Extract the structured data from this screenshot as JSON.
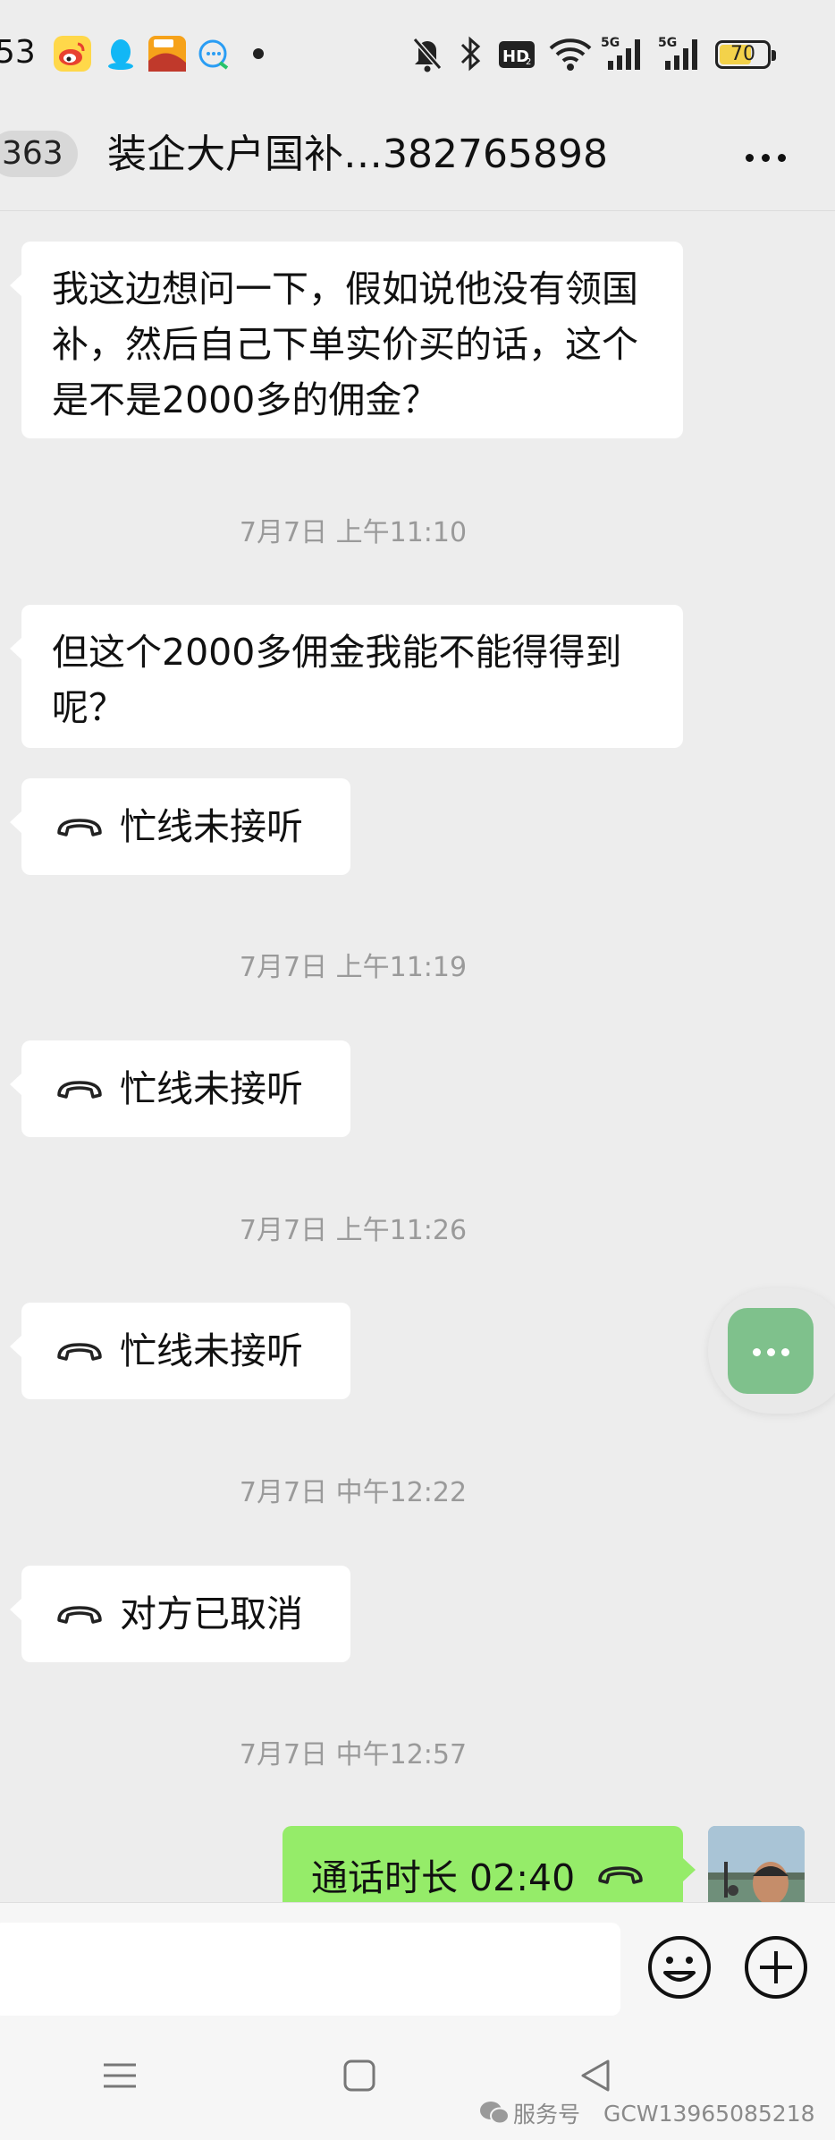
{
  "status_bar": {
    "time": "53",
    "battery": "70",
    "battery_level": 0.7,
    "signal_1": "5G",
    "signal_2": "5G",
    "hd_badge": "HD2"
  },
  "header": {
    "unread_count": "363",
    "title": "装企大户国补…382765898"
  },
  "messages": [
    {
      "type": "text",
      "text": "我这边想问一下，假如说他没有领国补，然后自己下单实价买的话，这个是不是2000多的佣金？"
    },
    {
      "type": "time",
      "text": "7月7日 上午11:10"
    },
    {
      "type": "text",
      "text": "但这个2000多佣金我能不能得得到呢？"
    },
    {
      "type": "call",
      "text": "忙线未接听"
    },
    {
      "type": "time",
      "text": "7月7日 上午11:19"
    },
    {
      "type": "call",
      "text": "忙线未接听"
    },
    {
      "type": "time",
      "text": "7月7日 上午11:26"
    },
    {
      "type": "call",
      "text": "忙线未接听"
    },
    {
      "type": "time",
      "text": "7月7日 中午12:22"
    },
    {
      "type": "call",
      "text": "对方已取消"
    },
    {
      "type": "time",
      "text": "7月7日 中午12:57"
    },
    {
      "type": "mine_call",
      "text": "通话时长 02:40"
    }
  ],
  "input": {
    "value": "",
    "placeholder": ""
  },
  "watermark": {
    "prefix": "服务号",
    "id": "GCW13965085218"
  },
  "colors": {
    "background": "#ededed",
    "my_bubble": "#95ec69",
    "their_bubble": "#ffffff",
    "timestamp": "#9a9a9a",
    "float_button": "#7fc18c"
  },
  "icons": [
    "weibo-icon",
    "qq-icon",
    "sohu-app-icon",
    "chat-app-icon",
    "mute-bell-icon",
    "bluetooth-icon",
    "hd-icon",
    "wifi-icon",
    "signal-icon",
    "battery-icon",
    "more-icon",
    "phone-hangup-icon",
    "emoji-icon",
    "plus-icon",
    "menu-icon",
    "home-icon",
    "back-icon",
    "wechat-icon"
  ]
}
